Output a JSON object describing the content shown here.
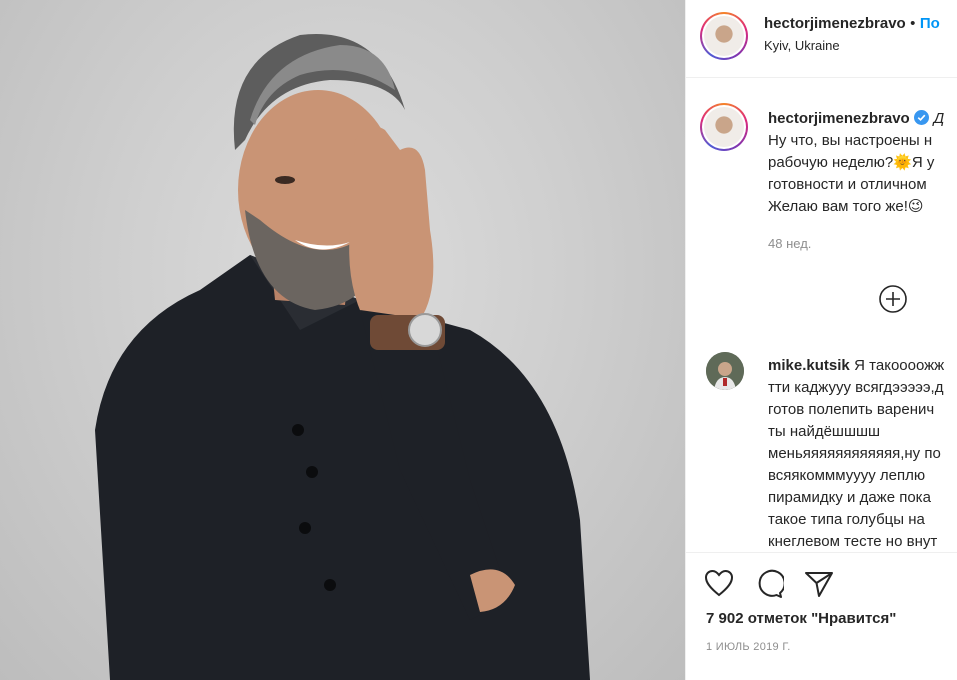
{
  "post": {
    "author": "hectorjimenezbravo",
    "follow_label": "По",
    "location": "Kyiv, Ukraine",
    "photo_icon": "person-photo"
  },
  "caption": {
    "author": "hectorjimenezbravo",
    "verified_icon": "verified-badge-icon",
    "lines": [
      "Д",
      "Ну что, вы настроены н",
      "рабочую неделю?🌞Я у",
      "готовности и отличном",
      "Желаю вам того же!😉"
    ],
    "age": "48 нед."
  },
  "load_more_icon": "plus-circle-icon",
  "comment": {
    "author": "mike.kutsik",
    "lines": [
      "Я такоооожж",
      "тти каджууу всягдэээээ,д",
      "готов полепить варенич",
      "ты найдёшшшш",
      "меньяяяяяяяяяяяя,ну по",
      "всяякомммуууу леплю",
      "пирамидку и даже пока",
      "такое типа голубцы на",
      "кнеглевом тесте но внут"
    ]
  },
  "actions": {
    "like_icon": "heart-icon",
    "comment_icon": "comment-icon",
    "share_icon": "share-icon"
  },
  "likes_text": "7 902 отметок \"Нравится\"",
  "date": "1 ИЮЛЬ 2019 Г.",
  "colors": {
    "link": "#0095f6",
    "text": "#262626",
    "muted": "#8e8e8e",
    "border": "#efefef"
  }
}
